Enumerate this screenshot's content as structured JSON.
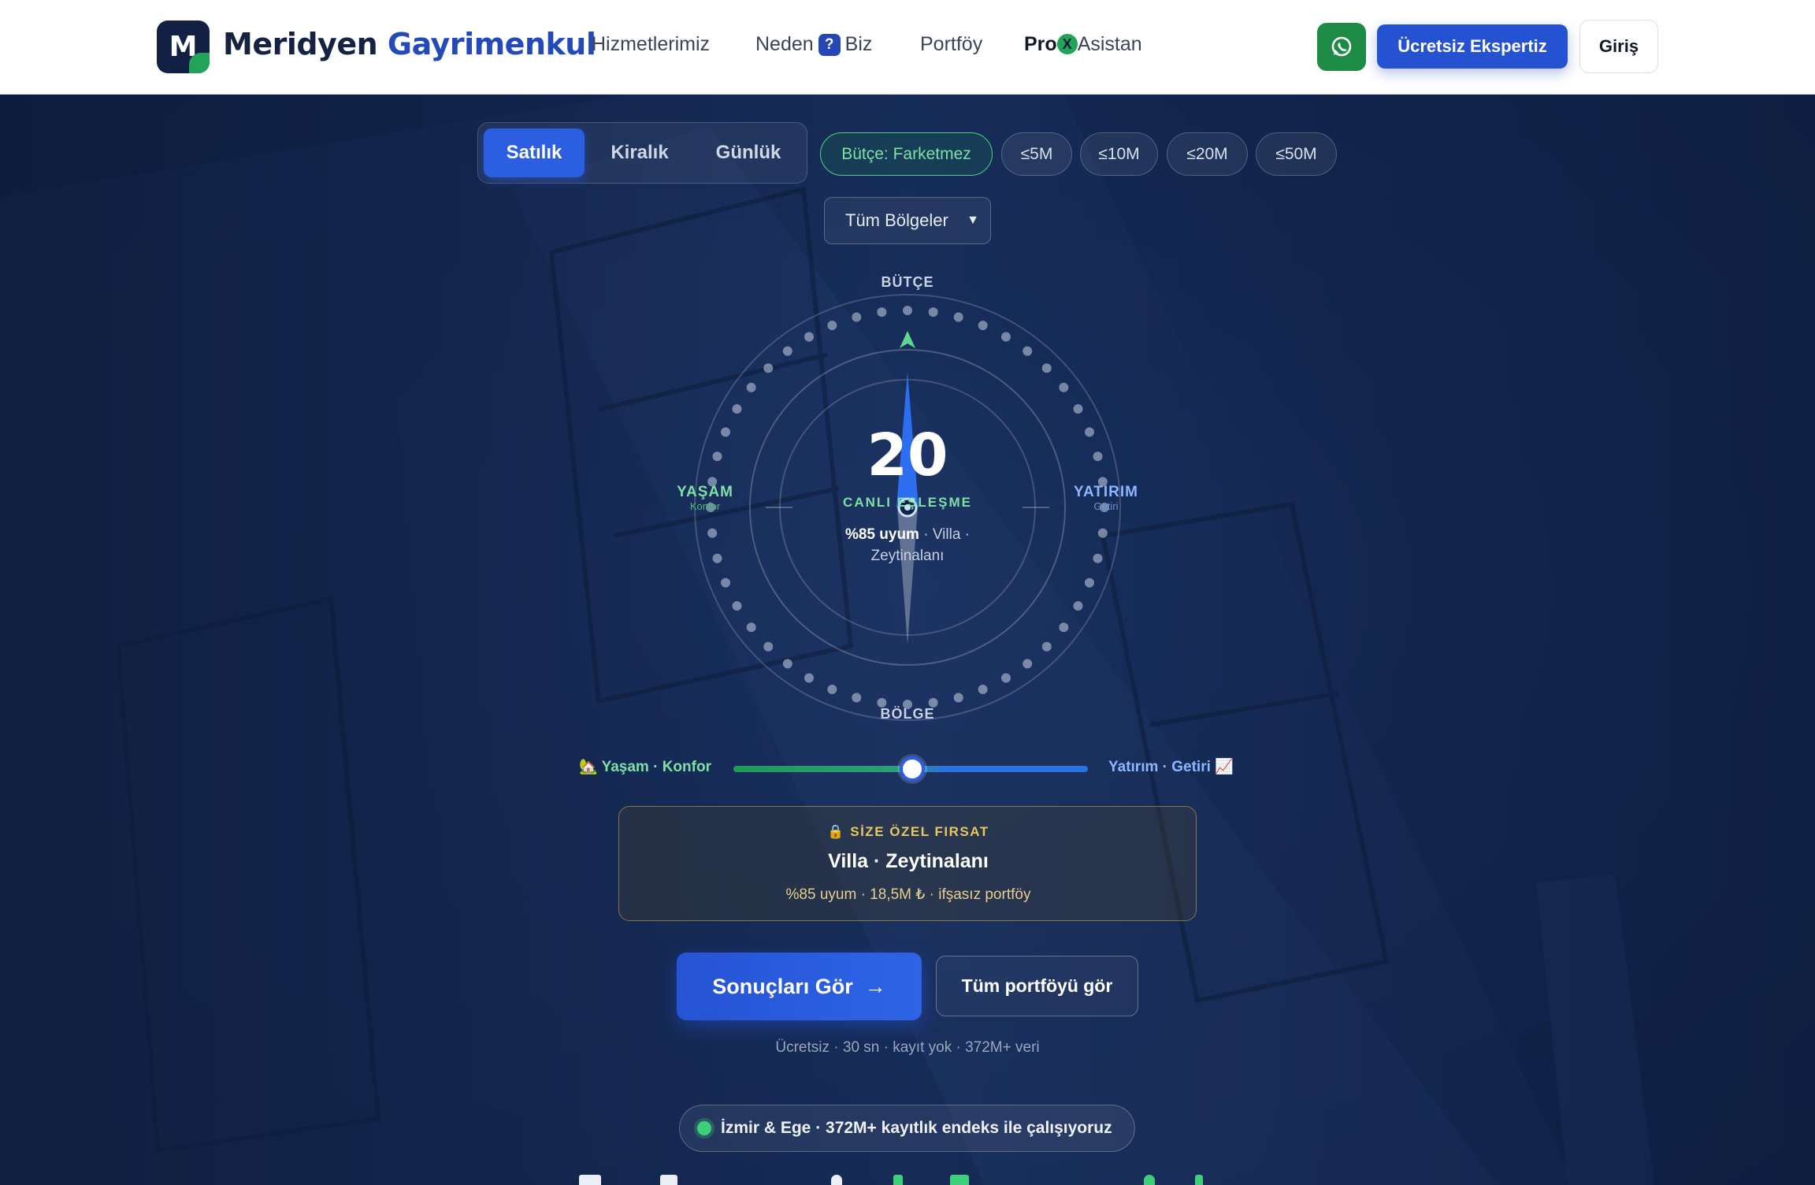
{
  "colors": {
    "brand_dark": "#152241",
    "brand_blue": "#2449b8",
    "accent_green": "#22a35a",
    "primary_button": "#2552d0",
    "hero_bg": "#142a55",
    "gold": "#e8c661"
  },
  "nav": {
    "logo_letter": "M",
    "brand_part1": "Meridyen",
    "brand_part2": "Gayrimenkul",
    "links": [
      {
        "label": "Hizmetlerimiz"
      },
      {
        "label_before": "Neden",
        "badge": "?",
        "label_after": "Biz"
      },
      {
        "label": "Portföy"
      },
      {
        "label_bold": "Pro",
        "badge": "X",
        "label_after": "Asistan"
      }
    ],
    "whatsapp_icon": "whatsapp-icon",
    "cta_label": "Ücretsiz Ekspertiz",
    "login_label": "Giriş"
  },
  "hero": {
    "tabs": [
      {
        "label": "Satılık",
        "active": true
      },
      {
        "label": "Kiralık",
        "active": false
      },
      {
        "label": "Günlük",
        "active": false
      }
    ],
    "budget_chips": [
      {
        "label": "Bütçe: Farketmez",
        "active": true
      },
      {
        "label": "≤5M",
        "active": false
      },
      {
        "label": "≤10M",
        "active": false
      },
      {
        "label": "≤20M",
        "active": false
      },
      {
        "label": "≤50M",
        "active": false
      }
    ],
    "region_select": {
      "selected": "Tüm Bölgeler"
    },
    "compass": {
      "top_label": "BÜTÇE",
      "bottom_label": "BÖLGE",
      "left_label": "YAŞAM",
      "left_sub": "Konfor",
      "right_label": "YATIRIM",
      "right_sub": "Getiri",
      "count": "20",
      "live_label": "CANLI EŞLEŞME",
      "match_strong": "%85 uyum",
      "match_rest": " · Villa · Zeytinalanı"
    },
    "slider": {
      "left_icon": "🏡",
      "left_label": "Yaşam · Konfor",
      "right_label": "Yatırım · Getiri",
      "right_icon": "📈",
      "value_fraction": 0.5
    },
    "offer": {
      "icon": "🔒",
      "tag": "SİZE ÖZEL FIRSAT",
      "title": "Villa · Zeytinalanı",
      "subtitle": "%85 uyum · 18,5M ₺ · ifşasız portföy"
    },
    "results_button": "Sonuçları Gör",
    "results_arrow": "→",
    "portfolio_button": "Tüm portföyü gör",
    "footnote": "Ücretsiz · 30 sn · kayıt yok · 372M+ veri",
    "status": "İzmir & Ege · 372M+ kayıtlık endeks ile çalışıyoruz"
  }
}
